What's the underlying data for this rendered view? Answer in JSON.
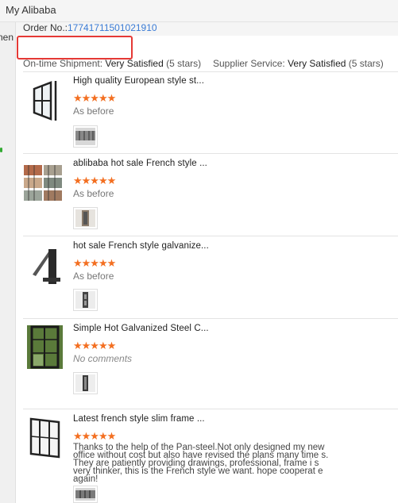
{
  "app": {
    "title": "My Alibaba"
  },
  "sidebar": {
    "fragment": "nen"
  },
  "order": {
    "label": "Order No.:",
    "number": "17741711501021910"
  },
  "ratings": {
    "shipment": {
      "label": "On-time Shipment:",
      "value": "Very Satisfied",
      "stars": "(5 stars)",
      "score": 5
    },
    "service": {
      "label": "Supplier Service:",
      "value": "Very Satisfied",
      "stars": "(5 stars)",
      "score": 5
    }
  },
  "colors": {
    "accent": "#3a7bd5",
    "star": "#f36f21",
    "highlight": "#e53935"
  },
  "reviews": [
    {
      "title": "High quality European style st...",
      "stars": "★★★★★",
      "rating": 5,
      "comment": "As before"
    },
    {
      "title": "ablibaba hot sale French style ...",
      "stars": "★★★★★",
      "rating": 5,
      "comment": "As before"
    },
    {
      "title": "hot sale French style galvanize...",
      "stars": "★★★★★",
      "rating": 5,
      "comment": "As before"
    },
    {
      "title": "Simple Hot Galvanized Steel C...",
      "stars": "★★★★★",
      "rating": 5,
      "comment": "No comments"
    },
    {
      "title": "Latest french style slim frame ...",
      "stars": "★★★★★",
      "rating": 5,
      "comment": "Thanks to the help of the Pan-steel.Not only designed my new office without cost but also have revised the plans many time s. They are patiently providing drawings, professional, frame i s very thinker, this is the French style we want. hope cooperat e again!"
    }
  ]
}
